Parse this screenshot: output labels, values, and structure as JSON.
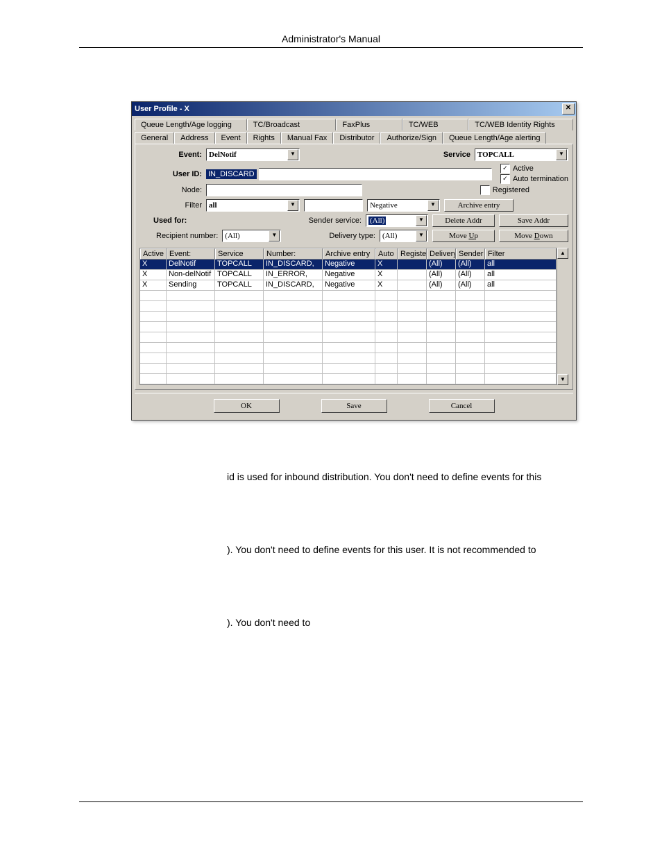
{
  "page": {
    "header_title": "Administrator's Manual"
  },
  "dialog": {
    "title": "User Profile - X",
    "close": "✕",
    "tabs_row1": [
      "Queue Length/Age logging",
      "TC/Broadcast",
      "FaxPlus",
      "TC/WEB",
      "TC/WEB Identity Rights"
    ],
    "tabs_row2": [
      "General",
      "Address",
      "Event",
      "Rights",
      "Manual Fax",
      "Distributor",
      "Authorize/Sign",
      "Queue Length/Age alerting"
    ],
    "active_tab": "Event",
    "labels": {
      "event": "Event:",
      "user_id": "User ID:",
      "node": "Node:",
      "filter": "Filter",
      "service": "Service",
      "used_for": "Used for:",
      "sender_service": "Sender service:",
      "recipient_number": "Recipient number:",
      "delivery_type": "Delivery type:",
      "active_chk": "Active",
      "auto_term_chk": "Auto termination",
      "registered_chk": "Registered",
      "archive_btn": "Archive entry",
      "delete_addr": "Delete Addr",
      "save_addr": "Save Addr",
      "move_up": "Move Up",
      "move_down": "Move Down",
      "ok": "OK",
      "save": "Save",
      "cancel": "Cancel"
    },
    "values": {
      "event": "DelNotif",
      "user_id": "IN_DISCARD",
      "node": "",
      "filter": "all",
      "filter2": "",
      "service": "TOPCALL",
      "archive_combo": "Negative",
      "sender_service": "(All)",
      "recipient_number": "(All)",
      "delivery_type": "(All)",
      "active_checked": true,
      "auto_term_checked": true,
      "registered_checked": false
    },
    "grid": {
      "headers": [
        "Active",
        "Event:",
        "Service",
        "Number:",
        "Archive entry",
        "Auto",
        "Registe",
        "Delivery",
        "Sender",
        "Filter"
      ],
      "rows": [
        {
          "active": "X",
          "event": "DelNotif",
          "service": "TOPCALL",
          "number": "IN_DISCARD,",
          "archive": "Negative",
          "auto": "X",
          "registe": "",
          "delivery": "(All)",
          "sender": "(All)",
          "filter": "all",
          "selected": true
        },
        {
          "active": "X",
          "event": "Non-delNotif",
          "service": "TOPCALL",
          "number": "IN_ERROR,",
          "archive": "Negative",
          "auto": "X",
          "registe": "",
          "delivery": "(All)",
          "sender": "(All)",
          "filter": "all",
          "selected": false
        },
        {
          "active": "X",
          "event": "Sending",
          "service": "TOPCALL",
          "number": "IN_DISCARD,",
          "archive": "Negative",
          "auto": "X",
          "registe": "",
          "delivery": "(All)",
          "sender": "(All)",
          "filter": "all",
          "selected": false
        }
      ]
    }
  },
  "body_text": {
    "t1": " id is used for inbound distribution. You don't need to define events for this",
    "t2": "). You don't need to define events for this user. It is not recommended to",
    "t3": "). You don't need to"
  }
}
